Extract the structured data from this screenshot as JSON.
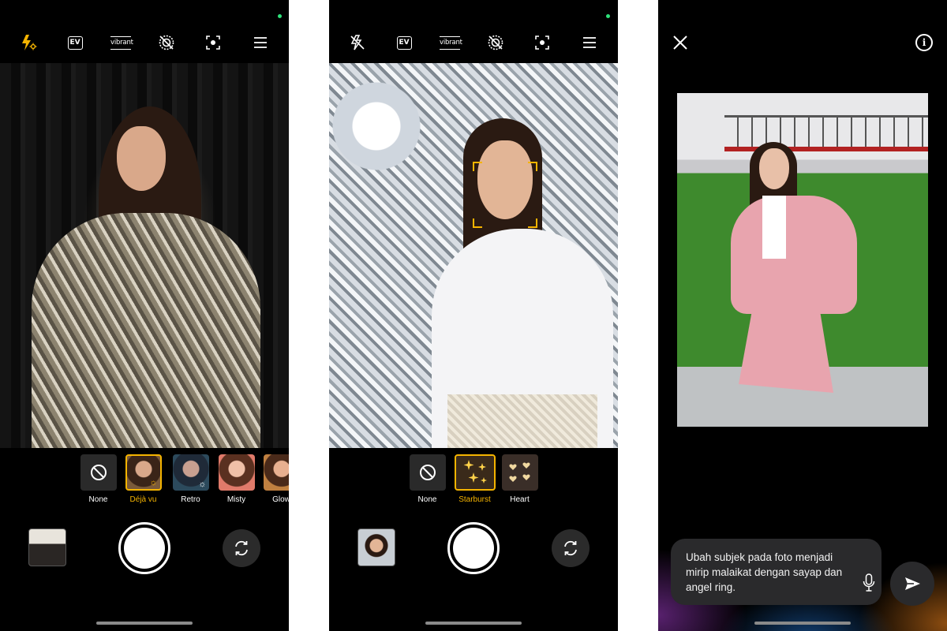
{
  "screen1": {
    "toolbar": [
      "flash-auto-icon",
      "ev-icon",
      "vibrant-icon",
      "live-off-icon",
      "focus-icon",
      "menu-icon"
    ],
    "ev_label": "EV",
    "vibrant_label": "vibrant",
    "filters": [
      {
        "label": "None",
        "selected": false
      },
      {
        "label": "Déjà vu",
        "selected": true
      },
      {
        "label": "Retro",
        "selected": false
      },
      {
        "label": "Misty",
        "selected": false
      },
      {
        "label": "Glow",
        "selected": false
      }
    ]
  },
  "screen2": {
    "toolbar": [
      "flash-off-icon",
      "ev-icon",
      "vibrant-icon",
      "live-off-icon",
      "focus-icon",
      "menu-icon"
    ],
    "ev_label": "EV",
    "vibrant_label": "vibrant",
    "filters": [
      {
        "label": "None",
        "selected": false
      },
      {
        "label": "Starburst",
        "selected": true
      },
      {
        "label": "Heart",
        "selected": false
      }
    ]
  },
  "screen3": {
    "info_label": "i",
    "prompt_text": "Ubah subjek pada foto menjadi mirip malaikat dengan sayap dan angel ring."
  },
  "colors": {
    "accent": "#f5b400",
    "status_dot": "#2ee27a",
    "background": "#000000"
  }
}
